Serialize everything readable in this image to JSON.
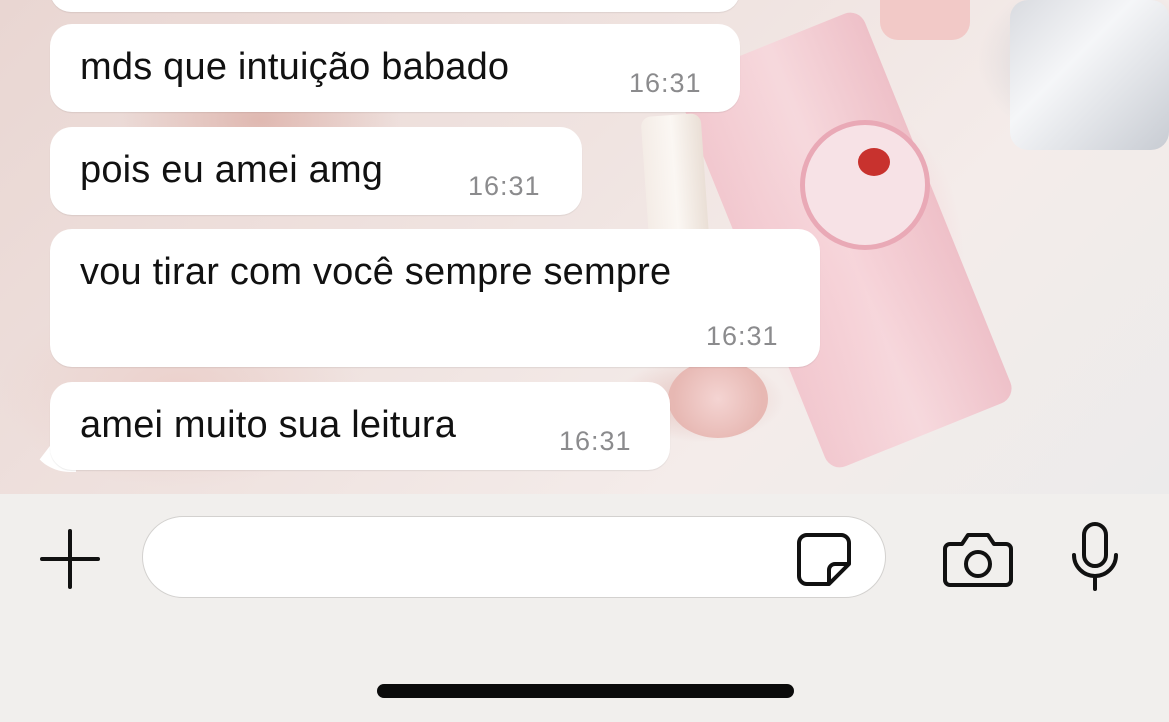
{
  "messages": [
    {
      "text": "mds que intuição babado",
      "time": "16:31"
    },
    {
      "text": "pois eu amei amg",
      "time": "16:31"
    },
    {
      "text": "vou tirar com você sempre sempre",
      "time": "16:31"
    },
    {
      "text": "amei muito sua leitura",
      "time": "16:31"
    }
  ],
  "composer": {
    "value": "",
    "placeholder": ""
  },
  "icons": {
    "attach": "plus-icon",
    "sticker": "sticker-icon",
    "camera": "camera-icon",
    "mic": "microphone-icon"
  },
  "colors": {
    "bubble": "#ffffff",
    "time_text": "#8b8b8d",
    "bar_background": "#f1efed"
  }
}
